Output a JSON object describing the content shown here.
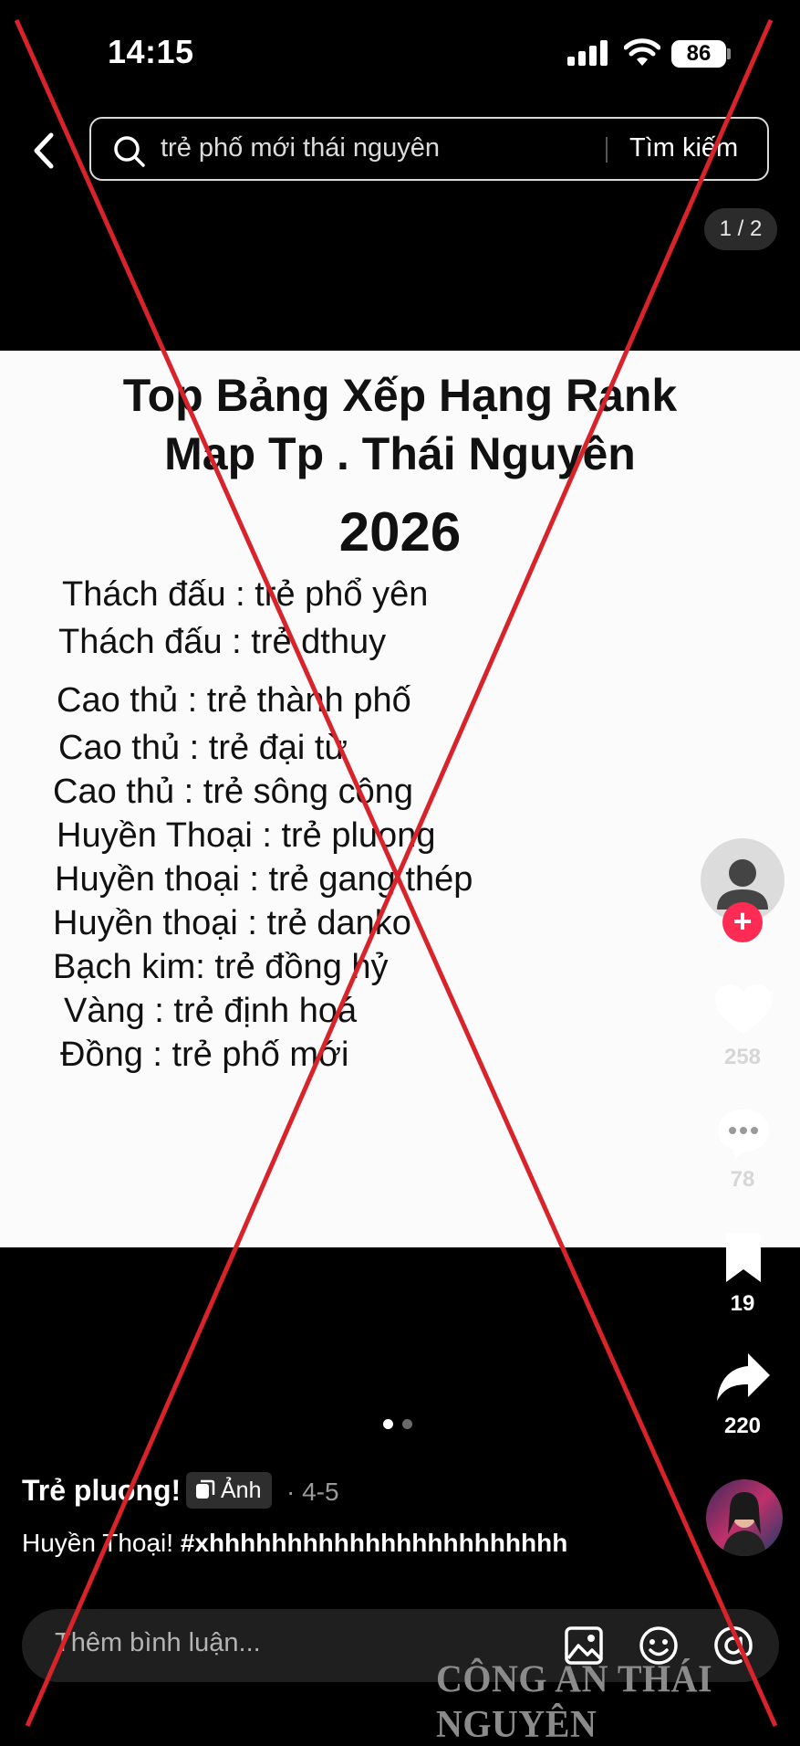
{
  "status_bar": {
    "time": "14:15",
    "battery": "86"
  },
  "search": {
    "query": "trẻ phố mới thái nguyên",
    "button_label": "Tìm kiếm"
  },
  "page_indicator": "1 / 2",
  "post_image": {
    "title_line1": "Top Bảng Xếp Hạng Rank",
    "title_line2": "Map Tp . Thái Nguyên",
    "title_year": "2026",
    "rankings": [
      "Thách đấu : trẻ phổ yên",
      "Thách đấu : trẻ dthuy",
      "Cao thủ : trẻ thành phố",
      "Cao thủ : trẻ đại từ",
      "Cao thủ : trẻ sông công",
      "Huyền Thoại : trẻ pluong",
      "Huyền thoại : trẻ gang thép",
      "Huyền thoại : trẻ danko",
      "Bạch kim: trẻ đồng hỷ",
      "Vàng : trẻ định hoá",
      "Đồng : trẻ phố mới"
    ]
  },
  "actions": {
    "likes": "258",
    "comments": "78",
    "saves": "19",
    "shares": "220"
  },
  "post_info": {
    "author": "Trẻ pluong!",
    "badge_label": "Ảnh",
    "date": "· 4-5",
    "caption_text": "Huyền Thoại! ",
    "hashtag": "#xhhhhhhhhhhhhhhhhhhhhhhh"
  },
  "comment": {
    "placeholder": "Thêm bình luận..."
  },
  "watermark": "CÔNG AN THÁI NGUYÊN",
  "colors": {
    "accent": "#fe2c55",
    "cross": "#d8232a"
  },
  "icons": [
    "back-arrow-icon",
    "search-icon",
    "heart-icon",
    "comment-icon",
    "bookmark-icon",
    "share-icon",
    "image-icon",
    "emoji-icon",
    "mention-icon"
  ]
}
